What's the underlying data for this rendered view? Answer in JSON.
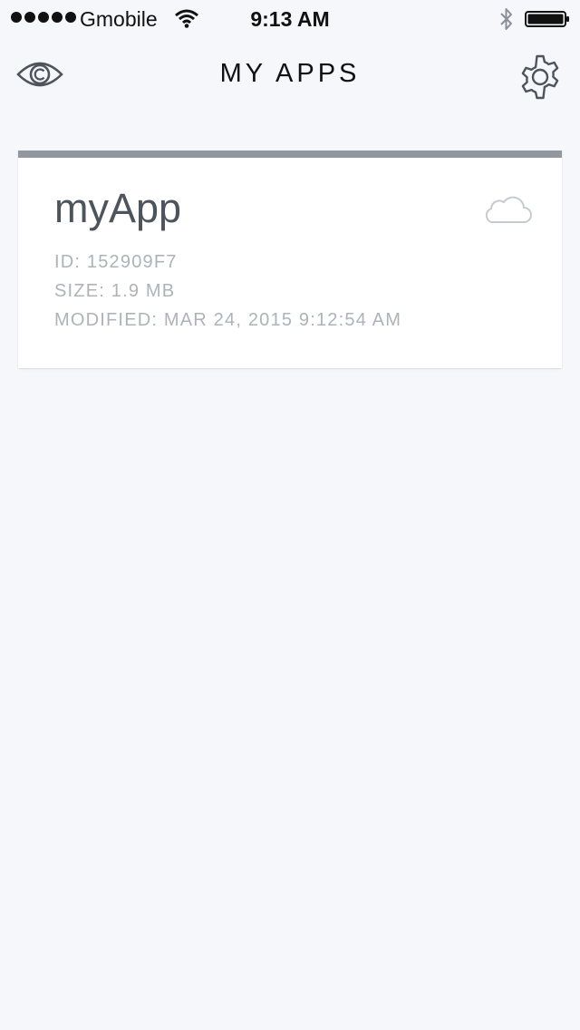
{
  "status_bar": {
    "carrier": "Gmobile",
    "time": "9:13 AM"
  },
  "nav": {
    "title": "MY APPS",
    "left_icon": "eye-icon",
    "right_icon": "gear-icon"
  },
  "apps": [
    {
      "name": "myApp",
      "id_text": "ID: 152909F7",
      "size_text": "SIZE: 1.9 MB",
      "modified_text": "MODIFIED: MAR 24, 2015 9:12:54 AM",
      "icon": "cloud-icon"
    }
  ],
  "colors": {
    "background": "#f6f7fb",
    "card_top_bar": "#9097a1",
    "app_name": "#4e545c",
    "meta_text": "#aeb2ba"
  }
}
